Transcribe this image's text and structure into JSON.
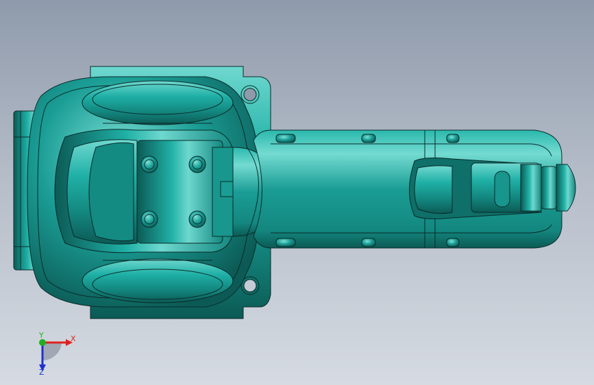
{
  "viewport": {
    "background_top": "#8f9aab",
    "background_bottom": "#d6dbe2"
  },
  "model": {
    "color_main": "#1a9d95",
    "color_highlight": "#6fd8cf",
    "color_shadow": "#0c5a55",
    "edge_color": "#0a2a28"
  },
  "triad": {
    "x_label": "X",
    "y_label": "Y",
    "z_label": "Z",
    "x_color": "#e02020",
    "y_color": "#20b020",
    "z_color": "#2030d0"
  }
}
